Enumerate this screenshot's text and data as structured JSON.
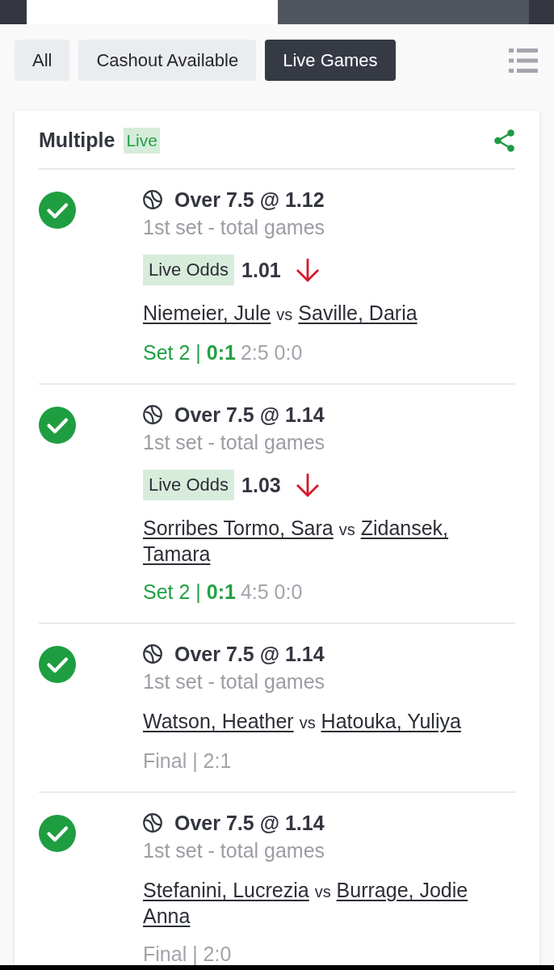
{
  "top_tabs": [
    {
      "selected": true
    },
    {
      "selected": false
    }
  ],
  "filters": [
    {
      "label": "All",
      "selected": false
    },
    {
      "label": "Cashout Available",
      "selected": false
    },
    {
      "label": "Live Games",
      "selected": true
    }
  ],
  "bet": {
    "title": "Multiple",
    "badge": "Live",
    "selections": [
      {
        "won": true,
        "market": "Over 7.5 @ 1.12",
        "description": "1st set - total games",
        "live_odds": {
          "label": "Live Odds",
          "value": "1.01",
          "falling": true
        },
        "home": "Niemeier, Jule",
        "vs": "vs",
        "away": "Saville, Daria",
        "score": {
          "kind": "live",
          "status": "Set 2 | **0:1**",
          "points": "2:5 0:0"
        }
      },
      {
        "won": true,
        "market": "Over 7.5 @ 1.14",
        "description": "1st set - total games",
        "live_odds": {
          "label": "Live Odds",
          "value": "1.03",
          "falling": true
        },
        "home": "Sorribes Tormo, Sara",
        "vs": "vs",
        "away": "Zidansek, Tamara",
        "score": {
          "kind": "live",
          "status": "Set 2 | **0:1**",
          "points": "4:5 0:0"
        }
      },
      {
        "won": true,
        "market": "Over 7.5 @ 1.14",
        "description": "1st set - total games",
        "home": "Watson, Heather",
        "vs": "vs",
        "away": "Hatouka, Yuliya",
        "score": {
          "kind": "final",
          "status": "Final | 2:1"
        }
      },
      {
        "won": true,
        "market": "Over 7.5 @ 1.14",
        "description": "1st set - total games",
        "home": "Stefanini, Lucrezia",
        "vs": "vs",
        "away": "Burrage, Jodie Anna",
        "score": {
          "kind": "final",
          "status": "Final | 2:0"
        }
      }
    ]
  }
}
